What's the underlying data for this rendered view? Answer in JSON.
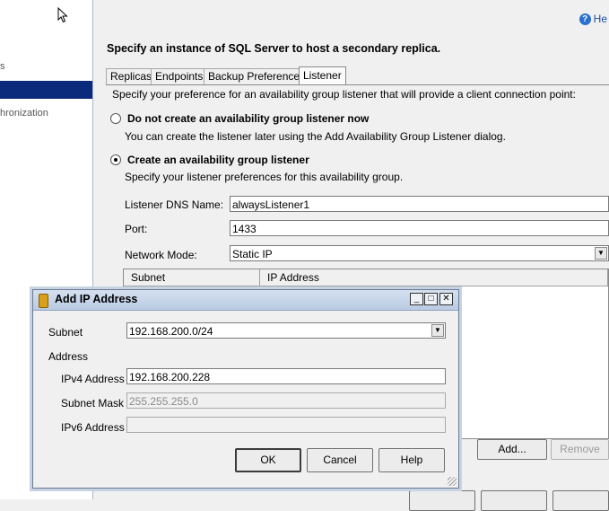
{
  "sidebar": {
    "items": [
      {
        "label": "s",
        "selected": false
      },
      {
        "label": "",
        "selected": true
      },
      {
        "label": "hronization",
        "selected": false
      }
    ]
  },
  "help_link": {
    "label": "He"
  },
  "heading": "Specify an instance of SQL Server to host a secondary replica.",
  "tabs": [
    {
      "label": "Replicas",
      "active": false
    },
    {
      "label": "Endpoints",
      "active": false
    },
    {
      "label": "Backup Preferences",
      "active": false
    },
    {
      "label": "Listener",
      "active": true
    }
  ],
  "listener": {
    "intro": "Specify your preference for an availability group listener that will provide a client connection point:",
    "option_none": {
      "label": "Do not create an availability group listener now",
      "hint": "You can create the listener later using the Add Availability Group Listener dialog.",
      "selected": false
    },
    "option_create": {
      "label": "Create an availability group listener",
      "hint": "Specify your listener preferences for this availability group.",
      "selected": true
    },
    "dns_label": "Listener DNS Name:",
    "dns_value": "alwaysListener1",
    "port_label": "Port:",
    "port_value": "1433",
    "mode_label": "Network Mode:",
    "mode_value": "Static IP",
    "grid_columns": [
      "Subnet",
      "IP Address"
    ],
    "add_button": "Add...",
    "remove_button": "Remove"
  },
  "dialog": {
    "title": "Add IP Address",
    "subnet_label": "Subnet",
    "subnet_value": "192.168.200.0/24",
    "address_group": "Address",
    "ipv4_label": "IPv4 Address",
    "ipv4_value": "192.168.200.228",
    "mask_label": "Subnet Mask",
    "mask_value": "255.255.255.0",
    "ipv6_label": "IPv6 Address",
    "ipv6_value": "",
    "ok": "OK",
    "cancel": "Cancel",
    "help": "Help",
    "window_buttons": {
      "minimize": "_",
      "maximize": "□",
      "close": "✕"
    }
  },
  "colors": {
    "sidebar_selected": "#0a2a7c",
    "help_link": "#1a4fa0",
    "title_bar": "#c7d3e3"
  }
}
